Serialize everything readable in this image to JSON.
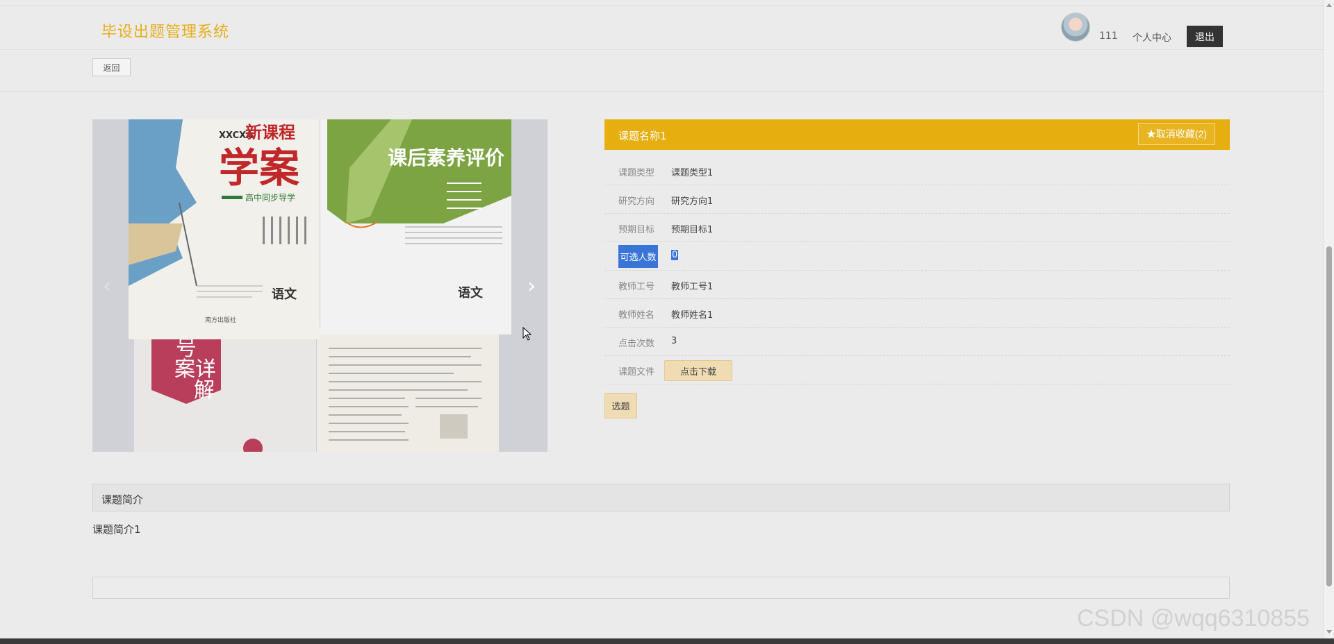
{
  "header": {
    "logo": "毕设出题管理系统",
    "username": "111",
    "user_center": "个人中心",
    "logout": "退出"
  },
  "back_button": "返回",
  "detail": {
    "title": "课题名称1",
    "favorite_button": "★取消收藏(2)",
    "fields": [
      {
        "label": "课题类型",
        "value": "课题类型1"
      },
      {
        "label": "研究方向",
        "value": "研究方向1"
      },
      {
        "label": "预期目标",
        "value": "预期目标1"
      },
      {
        "label": "可选人数",
        "value": "0"
      },
      {
        "label": "教师工号",
        "value": "教师工号1"
      },
      {
        "label": "教师姓名",
        "value": "教师姓名1"
      },
      {
        "label": "点击次数",
        "value": "3"
      },
      {
        "label": "课题文件",
        "button": "点击下载"
      }
    ],
    "select_button": "选题"
  },
  "carousel": {
    "book1": {
      "series": "XXCXA",
      "title1": "新课程",
      "title2": "学案",
      "subtitle": "高中同步导学",
      "subject": "语文",
      "publisher": "南方出版社"
    },
    "book2": {
      "title": "课后素养评价",
      "subject": "语文"
    },
    "book3": {
      "title_a": "号",
      "title_b": "案详",
      "title_c": "解"
    },
    "prev_icon": "‹",
    "next_icon": "›"
  },
  "intro": {
    "heading": "课题简介",
    "text": "课题简介1"
  },
  "watermark": "CSDN @wqq6310855",
  "colors": {
    "accent": "#e6ae0f",
    "logo": "#e8ad1a",
    "selection": "#3875d7"
  }
}
